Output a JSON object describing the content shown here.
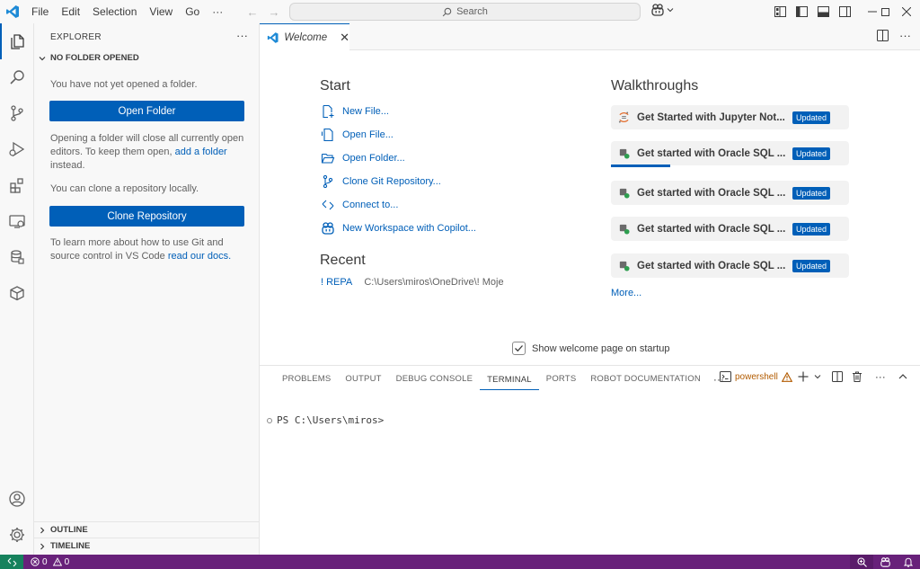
{
  "menu": [
    "File",
    "Edit",
    "Selection",
    "View",
    "Go"
  ],
  "menu_more": "···",
  "search": {
    "placeholder": "Search"
  },
  "sidebar": {
    "title": "EXPLORER",
    "more": "···",
    "section": "NO FOLDER OPENED",
    "text1": "You have not yet opened a folder.",
    "open_folder": "Open Folder",
    "text2_prefix": "Opening a folder will close all currently open editors. To keep them open,",
    "text2_link": "add a folder",
    "text2_suffix": "instead.",
    "text3": "You can clone a repository locally.",
    "clone": "Clone Repository",
    "text4_prefix": "To learn more about how to use Git and source control in VS Code",
    "text4_link": "read our docs.",
    "outline": "OUTLINE",
    "timeline": "TIMELINE"
  },
  "editor": {
    "tab_label": "Welcome",
    "start_heading": "Start",
    "start_items": [
      "New File...",
      "Open File...",
      "Open Folder...",
      "Clone Git Repository...",
      "Connect to...",
      "New Workspace with Copilot..."
    ],
    "recent_heading": "Recent",
    "recent": {
      "name": "! REPA",
      "path": "C:\\Users\\miros\\OneDrive\\! Moje"
    },
    "walkthroughs_heading": "Walkthroughs",
    "walkthroughs": [
      {
        "label": "Get Started with Jupyter Not...",
        "badge": "Updated"
      },
      {
        "label": "Get started with Oracle SQL ...",
        "badge": "Updated"
      },
      {
        "label": "Get started with Oracle SQL ...",
        "badge": "Updated"
      },
      {
        "label": "Get started with Oracle SQL ...",
        "badge": "Updated"
      },
      {
        "label": "Get started with Oracle SQL ...",
        "badge": "Updated"
      }
    ],
    "walkthrough_progress": 0.25,
    "more": "More...",
    "startup_label": "Show welcome page on startup",
    "startup_checked": true
  },
  "panel": {
    "tabs": [
      "PROBLEMS",
      "OUTPUT",
      "DEBUG CONSOLE",
      "TERMINAL",
      "PORTS",
      "ROBOT DOCUMENTATION"
    ],
    "active_tab": "TERMINAL",
    "more": "···",
    "shell": "powershell",
    "prompt": "PS C:\\Users\\miros>"
  },
  "status": {
    "errors": "0",
    "warnings": "0"
  },
  "colors": {
    "accent": "#005fb8",
    "statusbar": "#68217a",
    "remote": "#16825d",
    "warning": "#b25b00"
  }
}
